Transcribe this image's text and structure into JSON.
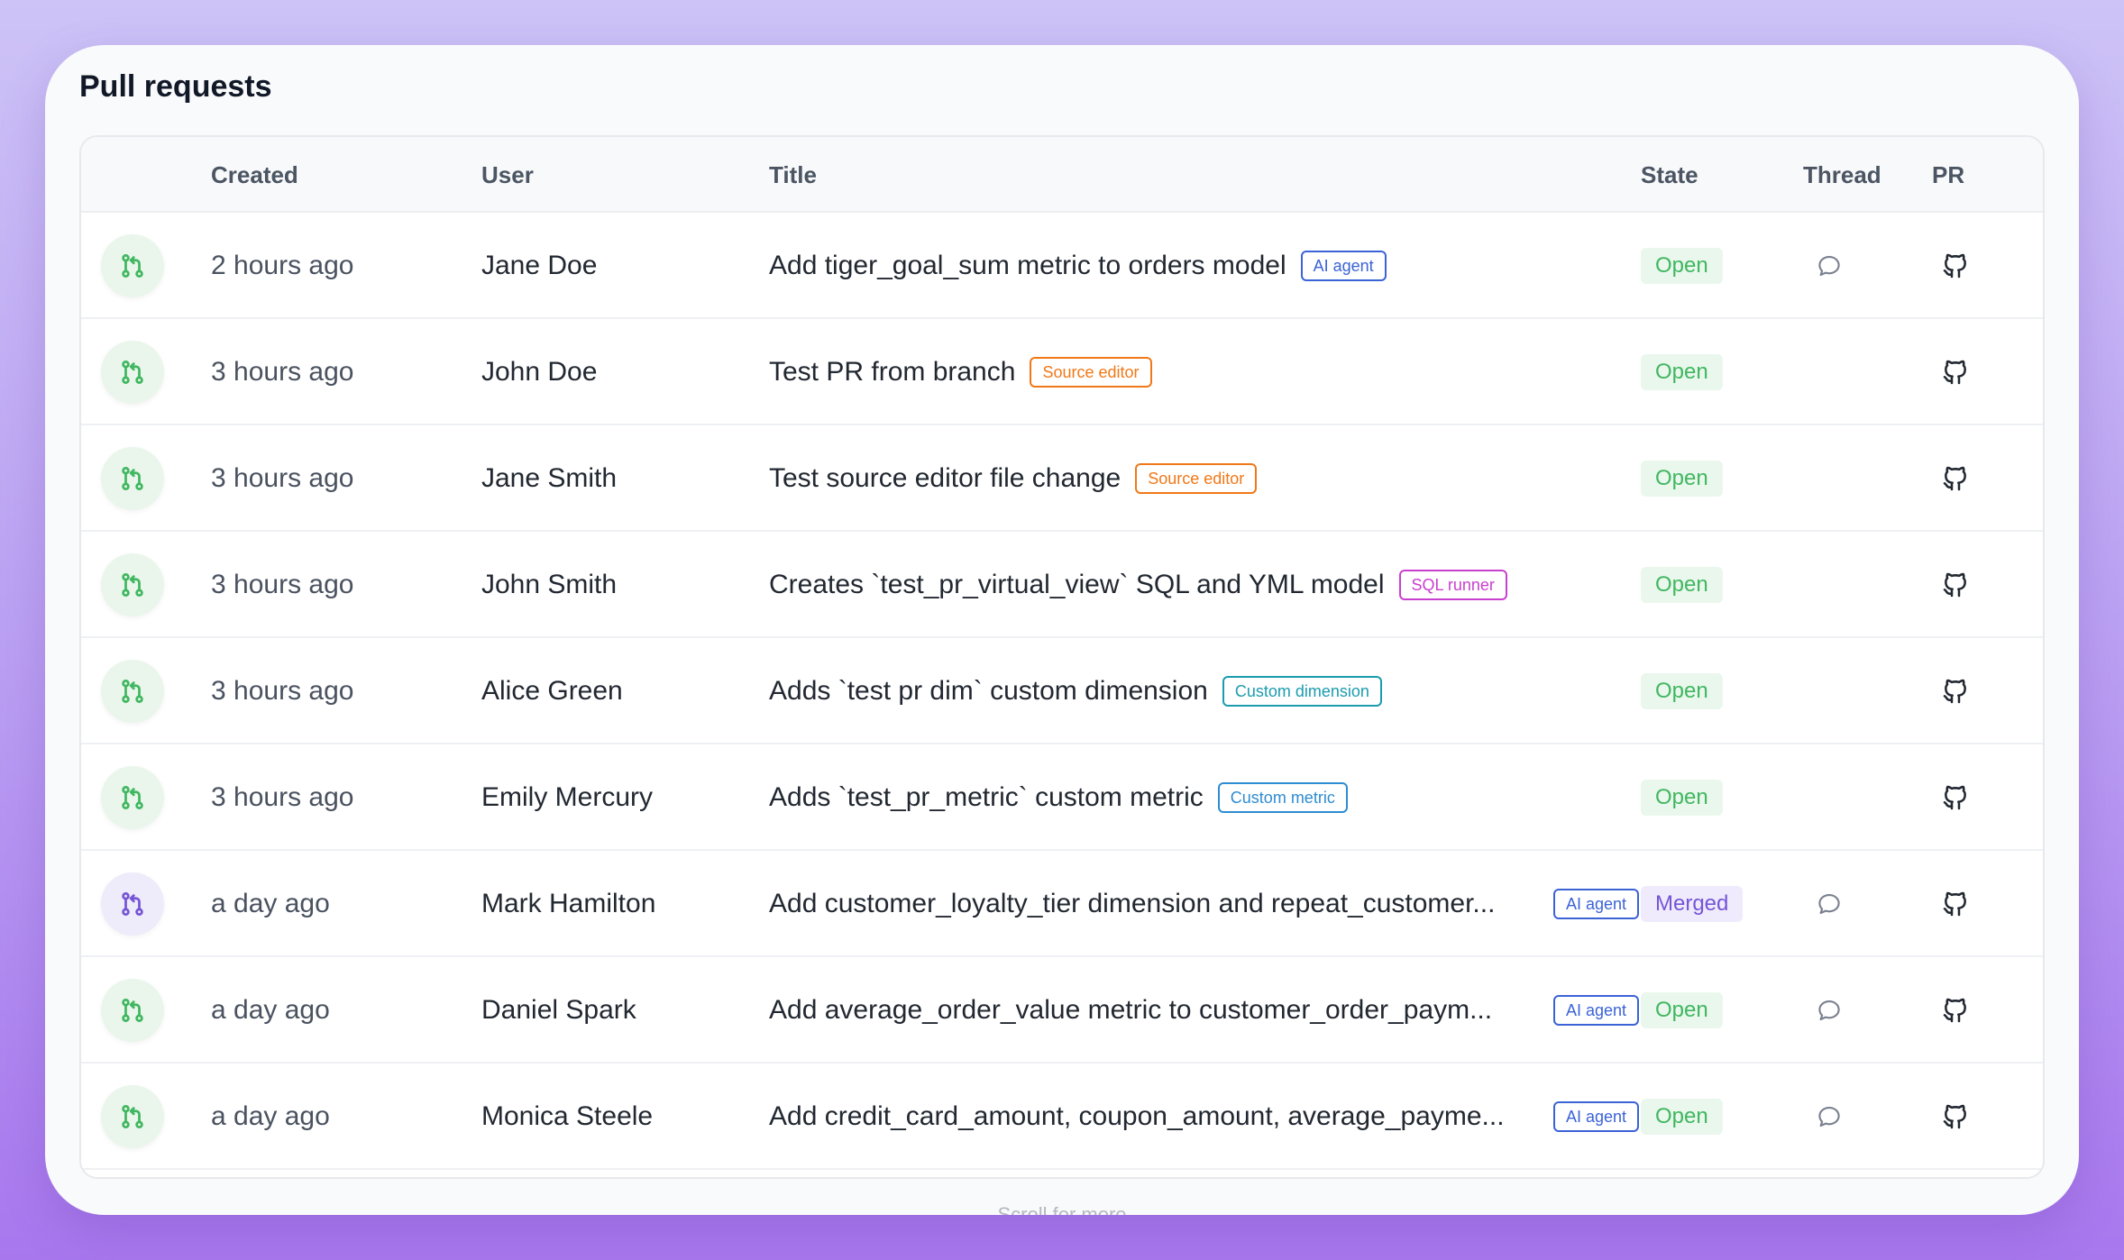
{
  "page_title": "Pull requests",
  "columns": {
    "created": "Created",
    "user": "User",
    "title": "Title",
    "state": "State",
    "thread": "Thread",
    "pr": "PR"
  },
  "colors": {
    "open": "#40b760",
    "merged": "#7555d6",
    "ai_agent": "#3b63d6",
    "source_editor": "#f07818",
    "sql_runner": "#c93fcf",
    "custom_dimension": "#1b9cae",
    "custom_metric": "#2e8cd1"
  },
  "rows": [
    {
      "status_icon": "git-pull-request-icon",
      "created": "2 hours ago",
      "user": "Jane Doe",
      "title": "Add tiger_goal_sum metric to orders model",
      "tag": "AI agent",
      "tag_kind": "ai",
      "state": "Open",
      "has_thread": true
    },
    {
      "status_icon": "git-pull-request-icon",
      "created": "3 hours ago",
      "user": "John Doe",
      "title": "Test PR from branch",
      "tag": "Source editor",
      "tag_kind": "source",
      "state": "Open",
      "has_thread": false
    },
    {
      "status_icon": "git-pull-request-icon",
      "created": "3 hours ago",
      "user": "Jane Smith",
      "title": "Test source editor file change",
      "tag": "Source editor",
      "tag_kind": "source",
      "state": "Open",
      "has_thread": false
    },
    {
      "status_icon": "git-pull-request-icon",
      "created": "3 hours ago",
      "user": "John Smith",
      "title": "Creates `test_pr_virtual_view` SQL and YML model",
      "tag": "SQL runner",
      "tag_kind": "sql",
      "state": "Open",
      "has_thread": false
    },
    {
      "status_icon": "git-pull-request-icon",
      "created": "3 hours ago",
      "user": "Alice Green",
      "title": "Adds `test pr dim` custom dimension",
      "tag": "Custom dimension",
      "tag_kind": "dim",
      "state": "Open",
      "has_thread": false
    },
    {
      "status_icon": "git-pull-request-icon",
      "created": "3 hours ago",
      "user": "Emily Mercury",
      "title": "Adds `test_pr_metric` custom metric",
      "tag": "Custom metric",
      "tag_kind": "metric",
      "state": "Open",
      "has_thread": false
    },
    {
      "status_icon": "git-merge-icon",
      "created": "a day ago",
      "user": "Mark Hamilton",
      "title": "Add customer_loyalty_tier dimension and repeat_customer...",
      "tag": "AI agent",
      "tag_kind": "ai",
      "state": "Merged",
      "has_thread": true
    },
    {
      "status_icon": "git-pull-request-icon",
      "created": "a day ago",
      "user": "Daniel Spark",
      "title": "Add average_order_value metric to customer_order_paym...",
      "tag": "AI agent",
      "tag_kind": "ai",
      "state": "Open",
      "has_thread": true
    },
    {
      "status_icon": "git-pull-request-icon",
      "created": "a day ago",
      "user": "Monica Steele",
      "title": "Add credit_card_amount, coupon_amount, average_payme...",
      "tag": "AI agent",
      "tag_kind": "ai",
      "state": "Open",
      "has_thread": true
    }
  ],
  "footer_hint": "Scroll for more"
}
